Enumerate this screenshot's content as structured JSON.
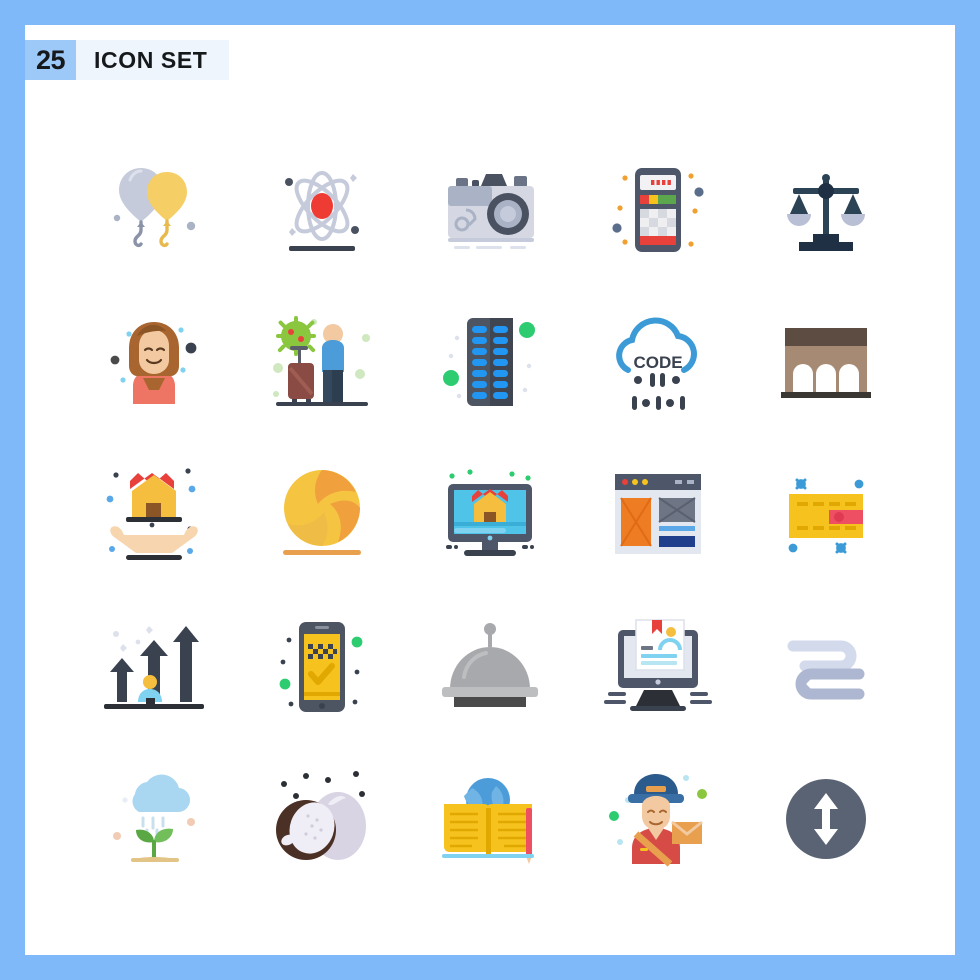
{
  "page": {
    "frame_color": "#7FB9F9",
    "background": "#FFFFFF"
  },
  "header": {
    "count": "25",
    "title": "ICON SET",
    "badge_color": "#9CC9F7",
    "title_bg": "#EFF5FC"
  },
  "grid": {
    "columns": 5,
    "rows": 5,
    "total": 25
  },
  "icons": [
    {
      "name": "balloons-icon",
      "label": "Balloons",
      "row": 1,
      "col": 1,
      "colors": [
        "#C6CBDB",
        "#F5CE65",
        "#8A93A8"
      ]
    },
    {
      "name": "atom-icon",
      "label": "Atom",
      "row": 1,
      "col": 2,
      "colors": [
        "#C6CBDB",
        "#EE3B33",
        "#3A4250"
      ]
    },
    {
      "name": "camera-icon",
      "label": "Camera",
      "row": 1,
      "col": 3,
      "colors": [
        "#D5D8E2",
        "#AAB2C5",
        "#4A5262"
      ]
    },
    {
      "name": "calculator-icon",
      "label": "Calculator",
      "row": 1,
      "col": 4,
      "colors": [
        "#4D5769",
        "#E84C3D",
        "#5CA64D"
      ]
    },
    {
      "name": "justice-scales-icon",
      "label": "Justice Scales",
      "row": 1,
      "col": 5,
      "colors": [
        "#1F3044",
        "#B9BFD4"
      ]
    },
    {
      "name": "woman-avatar-icon",
      "label": "Woman Avatar",
      "row": 2,
      "col": 1,
      "colors": [
        "#A8652F",
        "#F2C9A0",
        "#EE7463"
      ]
    },
    {
      "name": "travel-virus-icon",
      "label": "Traveler With Virus",
      "row": 2,
      "col": 2,
      "colors": [
        "#8BC63F",
        "#8A4B44",
        "#4B9CD8"
      ]
    },
    {
      "name": "server-rack-icon",
      "label": "Server Rack",
      "row": 2,
      "col": 3,
      "colors": [
        "#4D5562",
        "#2196F3",
        "#2ECC71"
      ]
    },
    {
      "name": "cloud-code-icon",
      "label": "Cloud Code",
      "row": 2,
      "col": 4,
      "text": "CODE",
      "colors": [
        "#3C9BD6",
        "#3A4250"
      ]
    },
    {
      "name": "aqueduct-bridge-icon",
      "label": "Aqueduct Bridge",
      "row": 2,
      "col": 5,
      "colors": [
        "#A68A74",
        "#5C4C42",
        "#3A3632"
      ]
    },
    {
      "name": "home-insurance-icon",
      "label": "Home Insurance",
      "row": 3,
      "col": 1,
      "colors": [
        "#F5BE3F",
        "#E8413C",
        "#F7D5AE"
      ]
    },
    {
      "name": "volleyball-icon",
      "label": "Volleyball",
      "row": 3,
      "col": 2,
      "colors": [
        "#F5C542",
        "#F08A34",
        "#E8A04E"
      ]
    },
    {
      "name": "online-property-icon",
      "label": "Online Property",
      "row": 3,
      "col": 3,
      "colors": [
        "#4FC3E8",
        "#F5BE3F",
        "#E8413C"
      ]
    },
    {
      "name": "web-layout-icon",
      "label": "Web Layout",
      "row": 3,
      "col": 4,
      "colors": [
        "#4D5769",
        "#EE7C22",
        "#1F3E8C"
      ]
    },
    {
      "name": "credit-card-icon",
      "label": "Credit Card",
      "row": 3,
      "col": 5,
      "colors": [
        "#F5C21E",
        "#EE4F63",
        "#3C9BD6"
      ]
    },
    {
      "name": "growth-arrows-icon",
      "label": "Growth Arrows",
      "row": 4,
      "col": 1,
      "colors": [
        "#3A4250",
        "#7FD2F0",
        "#F5BE3F"
      ]
    },
    {
      "name": "taxi-app-icon",
      "label": "Taxi App",
      "row": 4,
      "col": 2,
      "colors": [
        "#F5C21E",
        "#4D5562",
        "#2ECC71"
      ]
    },
    {
      "name": "food-cloche-icon",
      "label": "Food Cloche",
      "row": 4,
      "col": 3,
      "colors": [
        "#A7A9AC",
        "#BCBEC0",
        "#4A4A4A"
      ]
    },
    {
      "name": "certificate-screen-icon",
      "label": "Certificate Screen",
      "row": 4,
      "col": 4,
      "colors": [
        "#4D5769",
        "#E8413C",
        "#7FD2F0"
      ]
    },
    {
      "name": "zigzag-path-icon",
      "label": "Zigzag Path",
      "row": 4,
      "col": 5,
      "colors": [
        "#D3DAEC",
        "#AEB7D1"
      ]
    },
    {
      "name": "rain-seedling-icon",
      "label": "Rain Seedling",
      "row": 5,
      "col": 1,
      "colors": [
        "#A9D6F0",
        "#5AA844",
        "#E3C487"
      ]
    },
    {
      "name": "coconut-icon",
      "label": "Coconut",
      "row": 5,
      "col": 2,
      "colors": [
        "#4B3025",
        "#D8D4E4",
        "#EFEDF5"
      ]
    },
    {
      "name": "world-book-icon",
      "label": "World Book",
      "row": 5,
      "col": 3,
      "colors": [
        "#F5C21E",
        "#4B9CD8",
        "#EE4F63"
      ]
    },
    {
      "name": "postman-icon",
      "label": "Postman",
      "row": 5,
      "col": 4,
      "colors": [
        "#2B5A8C",
        "#D64B45",
        "#E8A04E"
      ]
    },
    {
      "name": "resize-vertical-icon",
      "label": "Resize Vertical",
      "row": 5,
      "col": 5,
      "colors": [
        "#5A6374",
        "#FFFFFF"
      ]
    }
  ]
}
